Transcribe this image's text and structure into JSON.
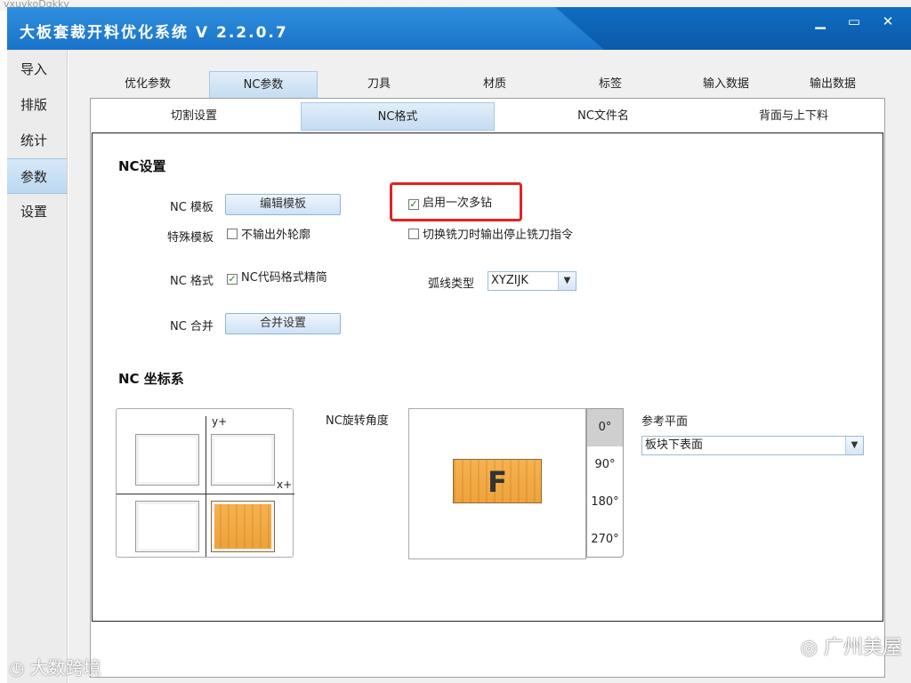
{
  "bg_text": "vxuvkoDqkkv",
  "window": {
    "title": "大板套裁开料优化系统 V 2.2.0.7",
    "minimize_glyph": "▁",
    "maximize_glyph": "▭",
    "close_glyph": "✕"
  },
  "sidebar": {
    "items": [
      {
        "label": "导入"
      },
      {
        "label": "排版"
      },
      {
        "label": "统计"
      },
      {
        "label": "参数",
        "active": true
      },
      {
        "label": "设置"
      }
    ]
  },
  "tabs": [
    {
      "label": "优化参数"
    },
    {
      "label": "NC参数",
      "active": true
    },
    {
      "label": "刀具"
    },
    {
      "label": "材质"
    },
    {
      "label": "标签"
    },
    {
      "label": "输入数据"
    },
    {
      "label": "输出数据"
    }
  ],
  "subtabs": [
    {
      "label": "切割设置"
    },
    {
      "label": "NC格式",
      "active": true
    },
    {
      "label": "NC文件名"
    },
    {
      "label": "背面与上下料"
    }
  ],
  "nc_settings": {
    "title": "NC设置",
    "template_label": "NC 模板",
    "edit_template_button": "编辑模板",
    "special_template_label": "特殊模板",
    "no_outline_label": "不输出外轮廓",
    "no_outline_checked": false,
    "enable_multi_drill_label": "启用一次多钻",
    "enable_multi_drill_checked": true,
    "switch_mill_label": "切换铣刀时输出停止铣刀指令",
    "switch_mill_checked": false,
    "format_label": "NC 格式",
    "simplify_label": "NC代码格式精简",
    "simplify_checked": true,
    "arc_type_label": "弧线类型",
    "arc_type_value": "XYZIJK",
    "merge_label": "NC 合并",
    "merge_button": "合并设置",
    "check_glyph": "✓"
  },
  "coord": {
    "title": "NC 坐标系",
    "y_axis": "y+",
    "x_axis": "x+",
    "rotation_label": "NC旋转角度",
    "rotation_options": [
      "0°",
      "90°",
      "180°",
      "270°"
    ],
    "rotation_selected": "0°",
    "board_letter": "F",
    "ref_plane_label": "参考平面",
    "ref_plane_value": "板块下表面"
  },
  "watermarks": {
    "right": "广州美屋",
    "left": "大数跨境"
  }
}
